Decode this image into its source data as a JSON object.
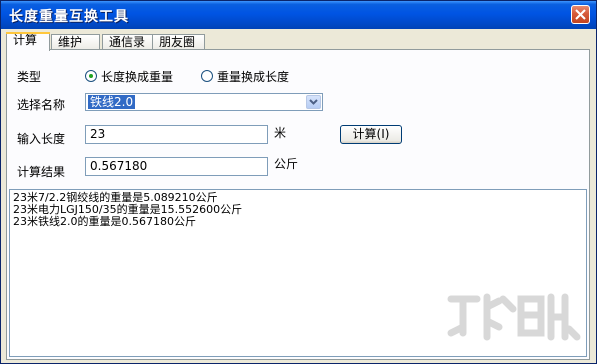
{
  "window": {
    "title": "长度重量互换工具"
  },
  "tabs": [
    {
      "label": "计算"
    },
    {
      "label": "维护"
    },
    {
      "label": "通信录"
    },
    {
      "label": "朋友圈"
    }
  ],
  "form": {
    "type_label": "类型",
    "radio_length_to_weight": "长度换成重量",
    "radio_weight_to_length": "重量换成长度",
    "selected_radio": "长度换成重量",
    "name_label": "选择名称",
    "name_value": "铁线2.0",
    "length_label": "输入长度",
    "length_value": "23",
    "length_unit": "米",
    "calc_button": "计算(I)",
    "result_label": "计算结果",
    "result_value": "0.567180",
    "result_unit": "公斤"
  },
  "output": {
    "lines": [
      "23米7/2.2钢绞线的重量是5.089210公斤",
      "23米电力LGJ150/35的重量是15.552600公斤",
      "23米铁线2.0的重量是0.567180公斤"
    ]
  },
  "colors": {
    "titlebar": "#0054e3",
    "selection": "#316ac5",
    "window_bg": "#ece9d8"
  }
}
